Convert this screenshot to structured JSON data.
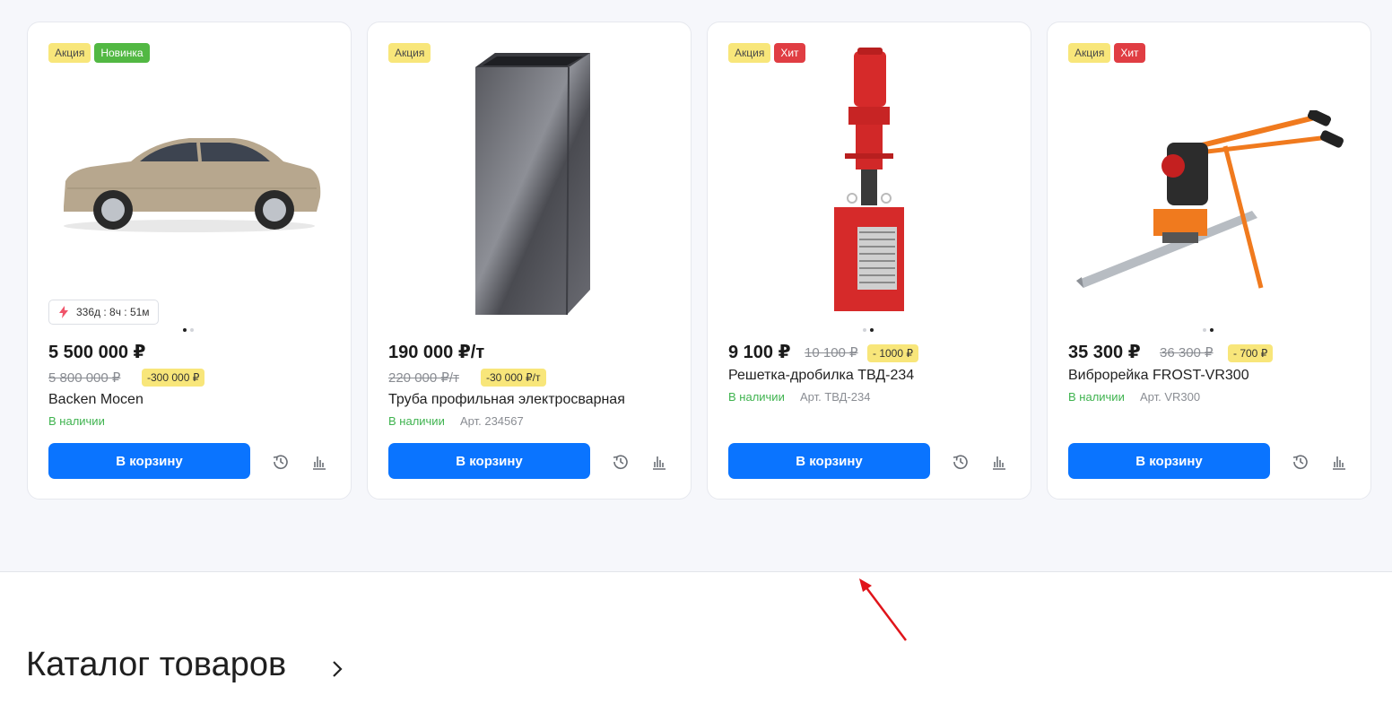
{
  "products": [
    {
      "badges": [
        "Акция",
        "Новинка"
      ],
      "timer": "336д : 8ч : 51м",
      "price": "5 500 000 ₽",
      "old_price": "5 800 000 ₽",
      "discount": "-300 000 ₽",
      "title": "Backen Mocen",
      "availability": "В наличии",
      "article": "",
      "cart_label": "В корзину"
    },
    {
      "badges": [
        "Акция"
      ],
      "price": "190 000 ₽/т",
      "old_price": "220 000 ₽/т",
      "discount": "-30 000 ₽/т",
      "title": "Труба профильная электросварная",
      "availability": "В наличии",
      "article": "Арт. 234567",
      "cart_label": "В корзину"
    },
    {
      "badges": [
        "Акция",
        "Хит"
      ],
      "price": "9 100 ₽",
      "old_price": "10 100 ₽",
      "discount": "- 1000 ₽",
      "title": "Решетка-дробилка ТВД-234",
      "availability": "В наличии",
      "article": "Арт. ТВД-234",
      "cart_label": "В корзину"
    },
    {
      "badges": [
        "Акция",
        "Хит"
      ],
      "price": "35 300 ₽",
      "old_price": "36 300 ₽",
      "discount": "- 700 ₽",
      "title": "Виброрейка FROST-VR300",
      "availability": "В наличии",
      "article": "Арт. VR300",
      "cart_label": "В корзину"
    }
  ],
  "catalog": {
    "heading": "Каталог товаров"
  },
  "colors": {
    "accent": "#0a74ff",
    "in_stock": "#3fb34f",
    "promo_badge": "#f8e67a",
    "new_badge": "#52b843",
    "hit_badge": "#e03d43"
  },
  "icons": [
    "lightning-icon",
    "history-icon",
    "compare-chart-icon",
    "chevron-right-icon",
    "red-arrow-annotation"
  ]
}
